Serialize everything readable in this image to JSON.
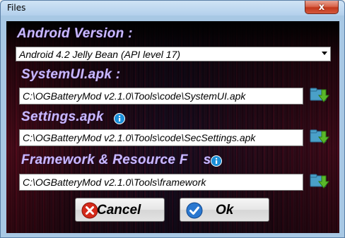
{
  "window": {
    "title": "Files",
    "close_glyph": "x"
  },
  "android_version": {
    "label": "Android Version :",
    "selected": "Android 4.2 Jelly Bean (API level 17)"
  },
  "systemui": {
    "label": "SystemUI.apk :",
    "path": "C:\\OGBatteryMod v2.1.0\\Tools\\code\\SystemUI.apk"
  },
  "settings": {
    "label": "Settings.apk",
    "path": "C:\\OGBatteryMod v2.1.0\\Tools\\code\\SecSettings.apk"
  },
  "framework": {
    "label_start": "Framework & Resource F",
    "label_end": "s :",
    "path": "C:\\OGBatteryMod v2.1.0\\Tools\\framework"
  },
  "buttons": {
    "cancel": "Cancel",
    "ok": "Ok"
  },
  "colors": {
    "label": "#c9b8ff",
    "info": "#1a8fd8",
    "browse_arrow": "#5ab82a",
    "cancel_icon": "#d42a1a",
    "ok_icon": "#2a78d0"
  },
  "icons": {
    "browse": "folder-arrow-icon",
    "info": "info-icon",
    "cancel": "cancel-x-icon",
    "ok": "check-icon"
  }
}
